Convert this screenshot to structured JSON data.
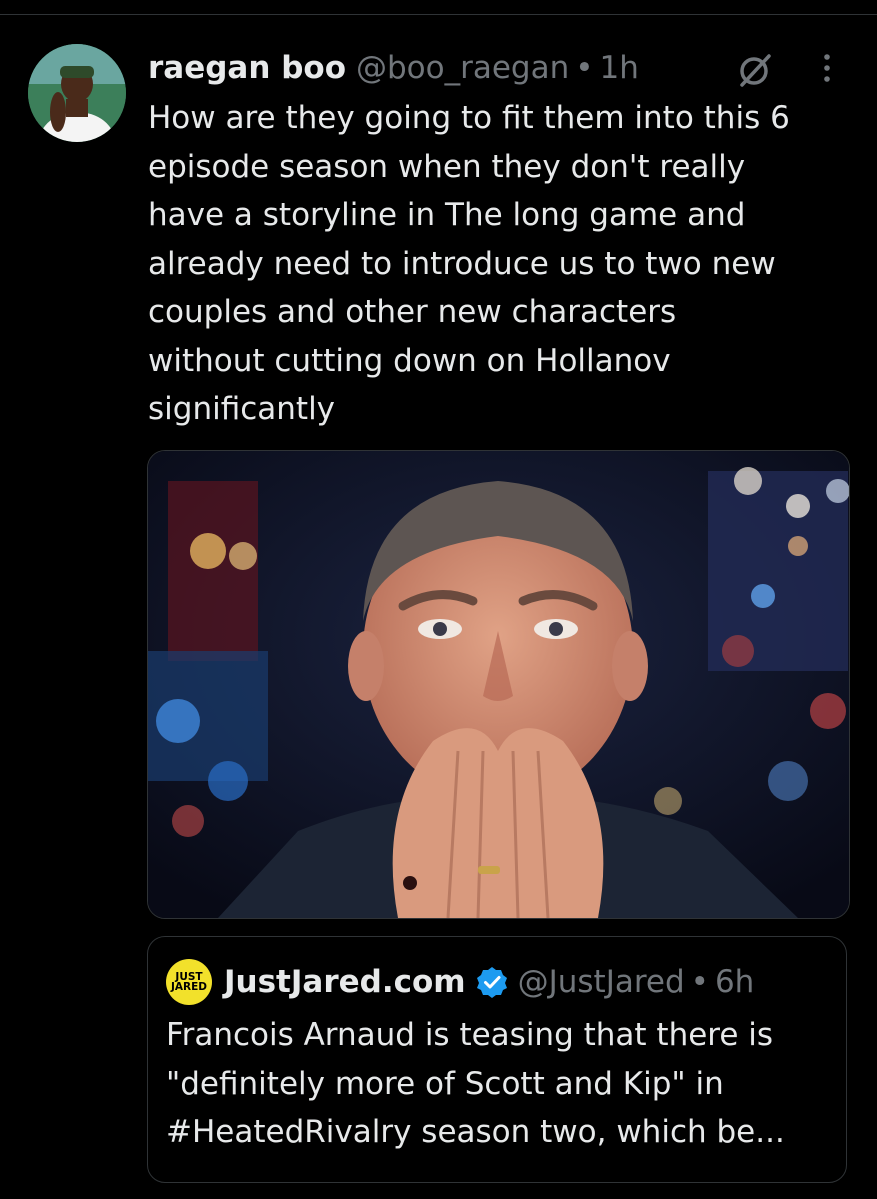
{
  "tweet": {
    "author_name": "raegan boo",
    "author_handle": "@boo_raegan",
    "separator": "•",
    "time": "1h",
    "text": "How are they going to fit them into this 6\nepisode season when they don't really\nhave a storyline in The long game and\nalready need to introduce us to two new\ncouples and other new characters\nwithout cutting down on Hollanov\nsignificantly"
  },
  "quote": {
    "logo_text_line1": "JUST",
    "logo_text_line2": "JARED",
    "author_name": "JustJared.com",
    "author_handle": "@JustJared",
    "separator": "•",
    "time": "6h",
    "text": "Francois Arnaud is teasing that there is\n\"definitely more of Scott and Kip\" in\n#HeatedRivalry season two, which be..."
  },
  "colors": {
    "background": "#000000",
    "text_primary": "#e7e9ea",
    "text_secondary": "#71767b",
    "border": "#2f3336",
    "verified_blue": "#1d9bf0",
    "logo_yellow": "#f2e12b"
  },
  "icons": {
    "grok": "grok-slash-circle-icon",
    "more": "more-vertical-icon",
    "verified": "verified-badge-icon"
  }
}
